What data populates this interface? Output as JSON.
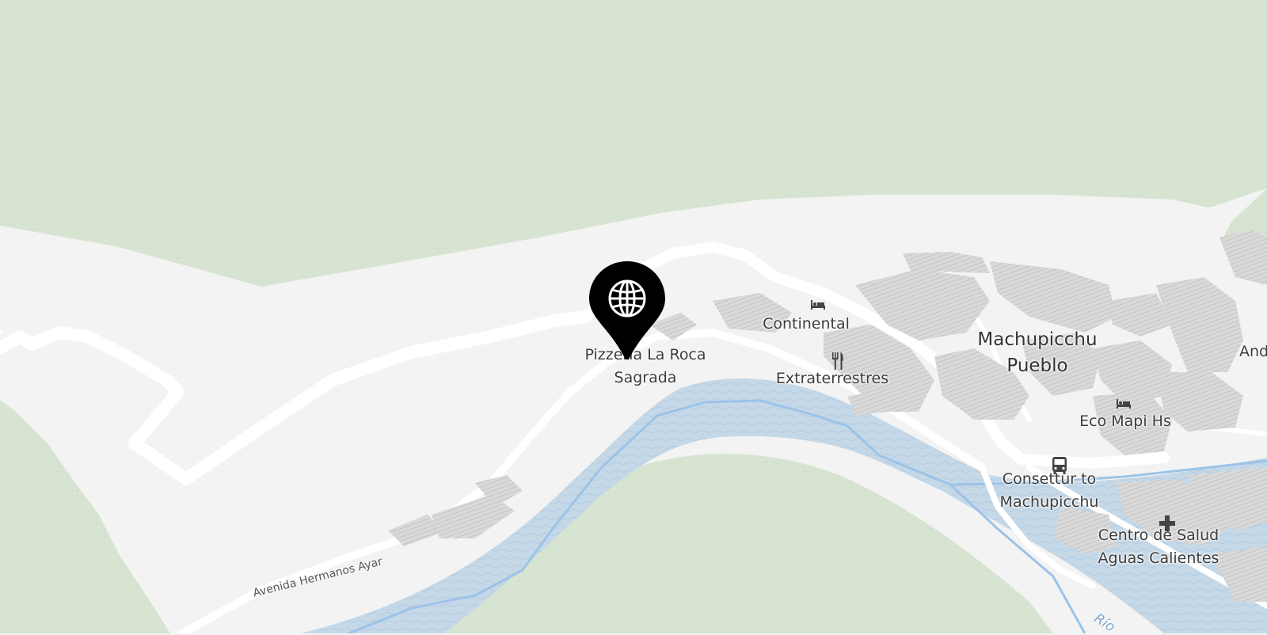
{
  "map": {
    "labels": {
      "pizzeria": "Pizzería La Roca Sagrada",
      "continental": "Continental",
      "extraterrestres": "Extraterrestres",
      "town": "Machupicchu Pueblo",
      "eco_mapi": "Eco Mapi Hs",
      "consettur": "Consettur to Machupicchu",
      "centro_salud": "Centro de Salud Aguas Calientes",
      "edge_cut": "And",
      "street": "Avenida Hermanos Ayar",
      "river": "Río"
    },
    "icons": {
      "selected_pin": "globe-pin-icon",
      "hotel": "bed-icon",
      "restaurant": "fork-knife-icon",
      "bus": "bus-icon",
      "health": "cross-icon"
    },
    "colors": {
      "forest": "#d8e4d2",
      "land": "#f3f3f3",
      "road": "#ffffff",
      "water": "#c3d6e6",
      "water_line": "#9cc3e8",
      "buildings": "#d6d6d6",
      "pin": "#000000"
    }
  }
}
